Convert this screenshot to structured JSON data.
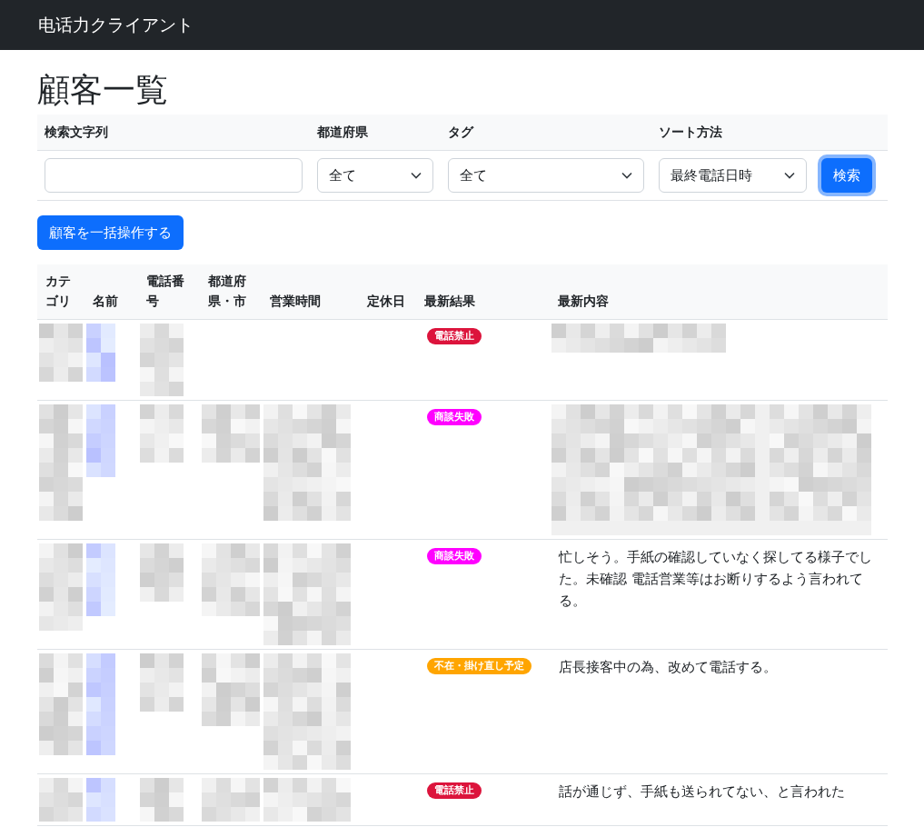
{
  "navbar": {
    "brand": "电话力クライアント"
  },
  "page_title": "顧客一覧",
  "filters": {
    "fields": [
      {
        "kind": "text",
        "label": "検索文字列"
      },
      {
        "kind": "select",
        "label": "都道府県",
        "value": "全て"
      },
      {
        "kind": "select",
        "label": "タグ",
        "value": "全て"
      },
      {
        "kind": "select",
        "label": "ソート方法",
        "value": "最終電話日時"
      }
    ],
    "search_button": {
      "label": "検索",
      "focused": true
    }
  },
  "bulk_button": {
    "label": "顧客を一括操作する"
  },
  "table": {
    "columns": [
      "カテゴリ",
      "名前",
      "電話番号",
      "都道府県・市",
      "営業時間",
      "定休日",
      "最新結果",
      "最新内容"
    ],
    "rows": [
      {
        "cells": [
          {
            "kind": "mosaic"
          },
          {
            "kind": "mosaic"
          },
          {
            "kind": "mosaic"
          },
          {
            "kind": "empty"
          },
          {
            "kind": "empty"
          },
          {
            "kind": "empty"
          }
        ],
        "result": {
          "label": "電話禁止",
          "color": "#dc143c"
        },
        "content": {
          "kind": "mosaic"
        }
      },
      {
        "cells": [
          {
            "kind": "mosaic"
          },
          {
            "kind": "mosaic"
          },
          {
            "kind": "mosaic"
          },
          {
            "kind": "mosaic"
          },
          {
            "kind": "mosaic"
          },
          {
            "kind": "empty"
          }
        ],
        "result": {
          "label": "商談失敗",
          "color": "#ff00ff"
        },
        "content": {
          "kind": "mosaic"
        }
      },
      {
        "cells": [
          {
            "kind": "mosaic"
          },
          {
            "kind": "mosaic"
          },
          {
            "kind": "mosaic"
          },
          {
            "kind": "mosaic"
          },
          {
            "kind": "mosaic"
          },
          {
            "kind": "empty"
          }
        ],
        "result": {
          "label": "商談失敗",
          "color": "#ff00ff"
        },
        "content": {
          "kind": "text",
          "text": "忙しそう。手紙の確認していなく探してる様子でした。未確認 電話営業等はお断りするよう言われてる。"
        }
      },
      {
        "cells": [
          {
            "kind": "mosaic"
          },
          {
            "kind": "mosaic"
          },
          {
            "kind": "mosaic"
          },
          {
            "kind": "mosaic"
          },
          {
            "kind": "mosaic"
          },
          {
            "kind": "empty"
          }
        ],
        "result": {
          "label": "不在・掛け直し予定",
          "color": "#ffa500"
        },
        "content": {
          "kind": "text",
          "text": "店長接客中の為、改めて電話する。"
        }
      },
      {
        "cells": [
          {
            "kind": "mosaic"
          },
          {
            "kind": "mosaic"
          },
          {
            "kind": "mosaic"
          },
          {
            "kind": "mosaic"
          },
          {
            "kind": "mosaic"
          },
          {
            "kind": "empty"
          }
        ],
        "result": {
          "label": "電話禁止",
          "color": "#dc143c"
        },
        "content": {
          "kind": "text",
          "text": "話が通じず、手紙も送られてない、と言われた"
        }
      }
    ]
  }
}
